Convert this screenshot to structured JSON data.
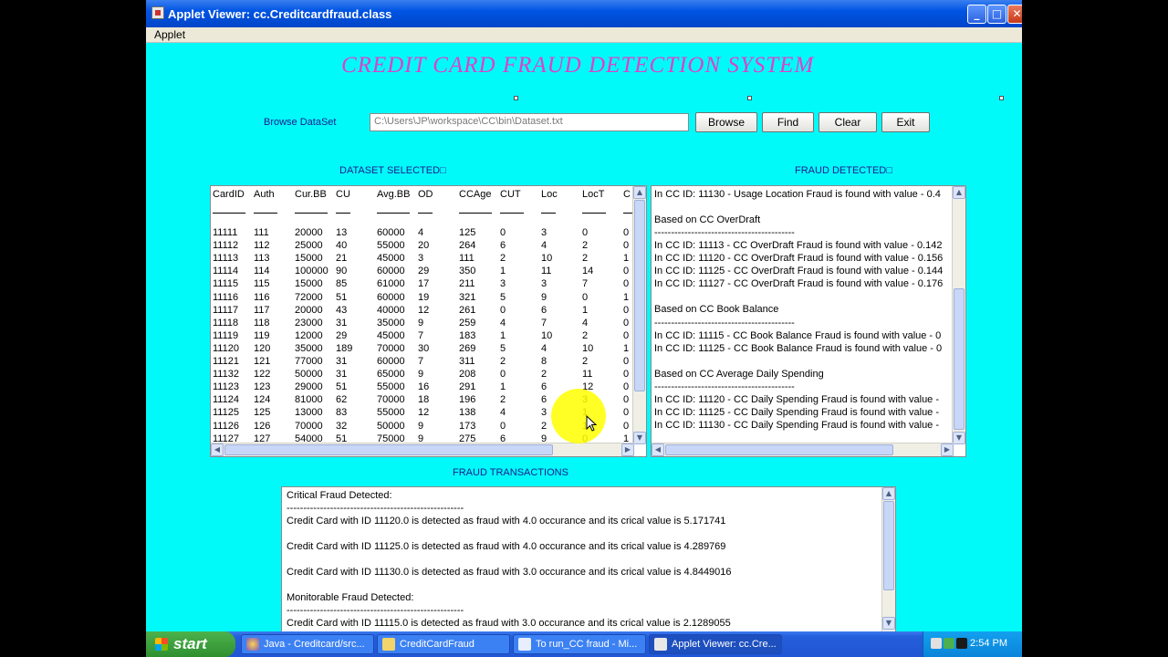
{
  "window": {
    "title": "Applet Viewer: cc.Creditcardfraud.class"
  },
  "menu": {
    "applet": "Applet"
  },
  "heading": "CREDIT CARD FRAUD DETECTION SYSTEM",
  "browse": {
    "label": "Browse DataSet",
    "path": "C:\\Users\\JP\\workspace\\CC\\bin\\Dataset.txt",
    "buttons": {
      "browse": "Browse",
      "find": "Find",
      "clear": "Clear",
      "exit": "Exit"
    }
  },
  "dataset": {
    "label": "DATASET SELECTED□",
    "headers": [
      "CardID",
      "Auth",
      "Cur.BB",
      "CU",
      "Avg.BB",
      "OD",
      "CCAge",
      "CUT",
      "Loc",
      "LocT",
      "C"
    ],
    "rows": [
      [
        "11111",
        "111",
        "20000",
        "13",
        "60000",
        "4",
        "125",
        "0",
        "3",
        "0",
        "0"
      ],
      [
        "11112",
        "112",
        "25000",
        "40",
        "55000",
        "20",
        "264",
        "6",
        "4",
        "2",
        "0"
      ],
      [
        "11113",
        "113",
        "15000",
        "21",
        "45000",
        "3",
        "111",
        "2",
        "10",
        "2",
        "1"
      ],
      [
        "11114",
        "114",
        "100000",
        "90",
        "60000",
        "29",
        "350",
        "1",
        "11",
        "14",
        "0"
      ],
      [
        "11115",
        "115",
        "15000",
        "85",
        "61000",
        "17",
        "211",
        "3",
        "3",
        "7",
        "0"
      ],
      [
        "11116",
        "116",
        "72000",
        "51",
        "60000",
        "19",
        "321",
        "5",
        "9",
        "0",
        "1"
      ],
      [
        "11117",
        "117",
        "20000",
        "43",
        "40000",
        "12",
        "261",
        "0",
        "6",
        "1",
        "0"
      ],
      [
        "11118",
        "118",
        "23000",
        "31",
        "35000",
        "9",
        "259",
        "4",
        "7",
        "4",
        "0"
      ],
      [
        "11119",
        "119",
        "12000",
        "29",
        "45000",
        "7",
        "183",
        "1",
        "10",
        "2",
        "0"
      ],
      [
        "11120",
        "120",
        "35000",
        "189",
        "70000",
        "30",
        "269",
        "5",
        "4",
        "10",
        "1"
      ],
      [
        "11121",
        "121",
        "77000",
        "31",
        "60000",
        "7",
        "311",
        "2",
        "8",
        "2",
        "0"
      ],
      [
        "11132",
        "122",
        "50000",
        "31",
        "65000",
        "9",
        "208",
        "0",
        "2",
        "11",
        "0"
      ],
      [
        "11123",
        "123",
        "29000",
        "51",
        "55000",
        "16",
        "291",
        "1",
        "6",
        "12",
        "0"
      ],
      [
        "11124",
        "124",
        "81000",
        "62",
        "70000",
        "18",
        "196",
        "2",
        "6",
        "3",
        "0"
      ],
      [
        "11125",
        "125",
        "13000",
        "83",
        "55000",
        "12",
        "138",
        "4",
        "3",
        "1",
        "0"
      ],
      [
        "11126",
        "126",
        "70000",
        "32",
        "50000",
        "9",
        "173",
        "0",
        "2",
        "1",
        "0"
      ],
      [
        "11127",
        "127",
        "54000",
        "51",
        "75000",
        "9",
        "275",
        "6",
        "9",
        "0",
        "1"
      ]
    ]
  },
  "fraud": {
    "label": "FRAUD DETECTED□",
    "lines": [
      "In CC ID: 11130 - Usage Location Fraud is found with value - 0.4",
      "",
      "Based on CC OverDraft",
      "------------------------------------------",
      "In CC ID: 11113 - CC OverDraft Fraud is found with value - 0.142",
      "In CC ID: 11120 - CC OverDraft Fraud is found with value - 0.156",
      "In CC ID: 11125 - CC OverDraft Fraud is found with value - 0.144",
      "In CC ID: 11127 - CC OverDraft Fraud is found with value - 0.176",
      "",
      "Based on CC Book Balance",
      "------------------------------------------",
      "In CC ID: 11115 - CC Book Balance Fraud is found with value - 0",
      "In CC ID: 11125 - CC Book Balance Fraud is found with value - 0",
      "",
      "Based on CC Average Daily Spending",
      "------------------------------------------",
      "In CC ID: 11120 - CC Daily Spending Fraud is found with value -",
      "In CC ID: 11125 - CC Daily Spending Fraud is found with value -",
      "In CC ID: 11130 - CC Daily Spending Fraud is found with value -"
    ]
  },
  "transactions": {
    "label": "FRAUD TRANSACTIONS",
    "lines": [
      "Critical Fraud Detected:",
      "-----------------------------------------------------",
      "Credit Card with ID 11120.0 is detected as fraud with 4.0 occurance and its crical value is 5.171741",
      "",
      "Credit Card with ID 11125.0 is detected as fraud with 4.0 occurance and its crical value is 4.289769",
      "",
      "Credit Card with ID 11130.0 is detected as fraud with 3.0 occurance and its crical value is 4.8449016",
      "",
      "Monitorable Fraud Detected:",
      "-----------------------------------------------------",
      "Credit Card with ID 11115.0 is detected as fraud with 3.0 occurance and its crical value is 2.1289055"
    ]
  },
  "taskbar": {
    "start": "start",
    "tasks": [
      "Java - Creditcard/src...",
      "CreditCardFraud",
      "To run_CC fraud - Mi...",
      "Applet Viewer: cc.Cre..."
    ],
    "clock": "2:54 PM"
  },
  "colors": {
    "background": "#00fafa",
    "heading": "#e040c8",
    "label": "#1c1c8c",
    "titlebar": "#0054e3"
  }
}
